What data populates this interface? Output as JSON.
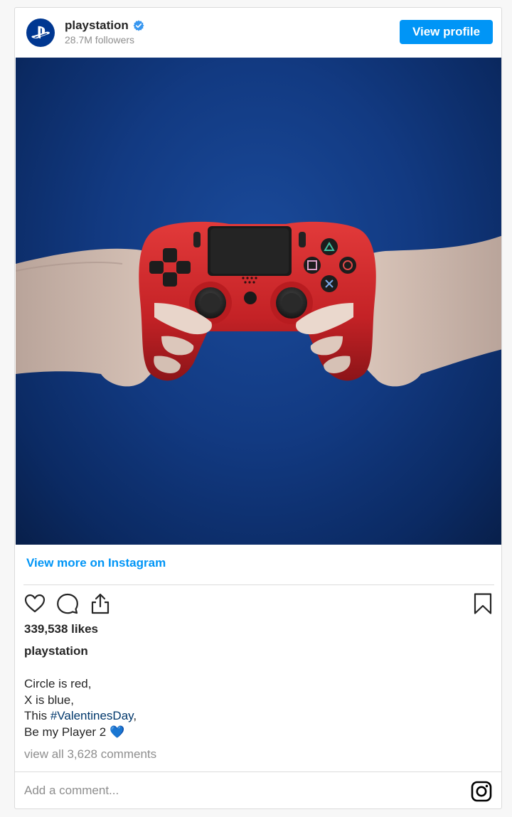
{
  "header": {
    "username": "playstation",
    "followers": "28.7M followers",
    "view_profile_label": "View profile",
    "avatar_icon": "playstation-logo-icon",
    "verified_icon": "verified-badge-icon"
  },
  "post": {
    "view_more_label": "View more on Instagram",
    "likes": "339,538 likes",
    "caption_user": "playstation",
    "caption_lines": {
      "line1": "Circle is red,",
      "line2": "X is blue,",
      "line3_prefix": "This ",
      "line3_hashtag": "#ValentinesDay",
      "line3_suffix": ",",
      "line4": "Be my Player 2 💙"
    },
    "comments": "view all 3,628 comments",
    "comment_placeholder": "Add a comment..."
  },
  "colors": {
    "accent": "#0095f6",
    "brand": "#003791",
    "hashtag": "#00376b"
  }
}
